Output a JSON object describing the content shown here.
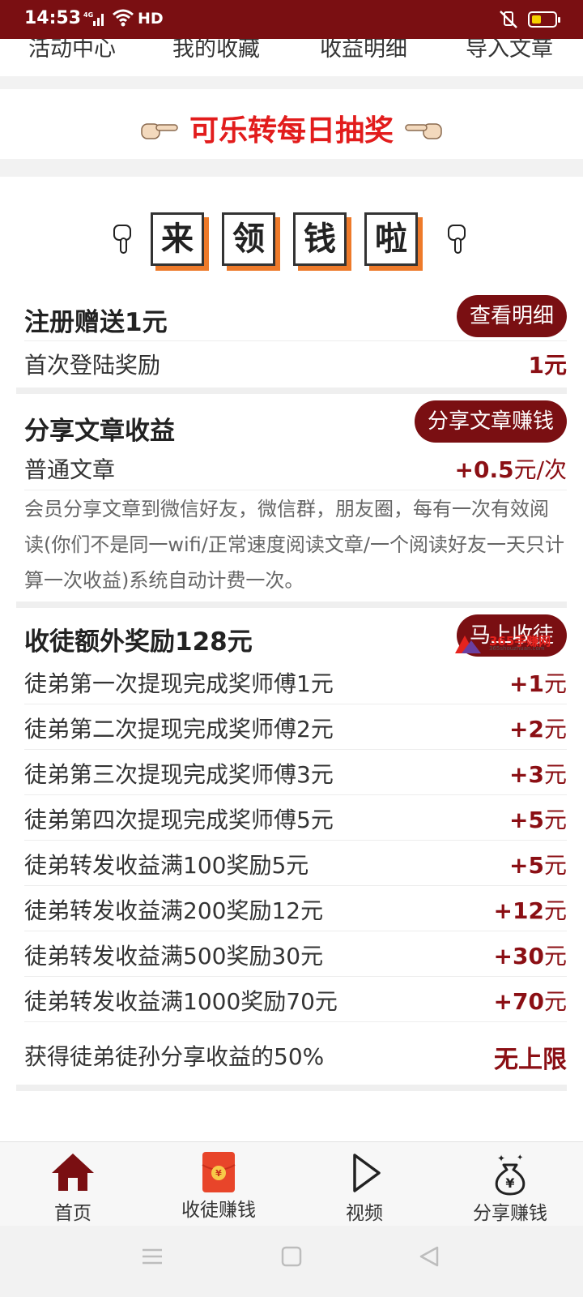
{
  "status_bar": {
    "time": "14:53",
    "network": "HD",
    "signal_icon": "signal-icon",
    "wifi_icon": "wifi-icon",
    "mute_icon": "mute-icon",
    "battery_icon": "battery-icon",
    "background_color": "#7a0f12"
  },
  "top_nav": {
    "items": [
      {
        "label": "活动中心"
      },
      {
        "label": "我的收藏"
      },
      {
        "label": "收益明细"
      },
      {
        "label": "导入文章"
      }
    ]
  },
  "lottery": {
    "text": "可乐转每日抽奖",
    "left_icon": "pointing-right-hand-icon",
    "right_icon": "pointing-left-hand-icon",
    "color": "#e21c1c"
  },
  "stamp_heading": {
    "chars": [
      "来",
      "领",
      "钱",
      "啦"
    ],
    "left_icon": "pointing-down-hand-icon",
    "right_icon": "pointing-down-hand-icon",
    "shadow_color": "#ee7a2a"
  },
  "register": {
    "title": "注册赠送1元",
    "button": "查看明细",
    "row_label": "首次登陆奖励",
    "row_value": "1元"
  },
  "share": {
    "title": "分享文章收益",
    "button": "分享文章赚钱",
    "row_label": "普通文章",
    "row_value_amount": "+0.5",
    "row_value_unit": "元/次",
    "description": "会员分享文章到微信好友，微信群，朋友圈，每有一次有效阅读(你们不是同一wifi/正常速度阅读文章/一个阅读好友一天只计算一次收益)系统自动计费一次。"
  },
  "apprentice": {
    "title": "收徒额外奖励128元",
    "button": "马上收徒",
    "rows": [
      {
        "label": "徒弟第一次提现完成奖师傅1元",
        "amount": "+1",
        "unit": "元"
      },
      {
        "label": "徒弟第二次提现完成奖师傅2元",
        "amount": "+2",
        "unit": "元"
      },
      {
        "label": "徒弟第三次提现完成奖师傅3元",
        "amount": "+3",
        "unit": "元"
      },
      {
        "label": "徒弟第四次提现完成奖师傅5元",
        "amount": "+5",
        "unit": "元"
      },
      {
        "label": "徒弟转发收益满100奖励5元",
        "amount": "+5",
        "unit": "元"
      },
      {
        "label": "徒弟转发收益满200奖励12元",
        "amount": "+12",
        "unit": "元"
      },
      {
        "label": "徒弟转发收益满500奖励30元",
        "amount": "+30",
        "unit": "元"
      },
      {
        "label": "徒弟转发收益满1000奖励70元",
        "amount": "+70",
        "unit": "元"
      }
    ],
    "final_label": "获得徒弟徒孙分享收益的50%",
    "final_value": "无上限"
  },
  "watermark": {
    "text": "365手赚网",
    "sub": "365shouzhuan.com"
  },
  "tab_bar": {
    "tabs": [
      {
        "label": "首页",
        "icon": "home-icon"
      },
      {
        "label": "收徒赚钱",
        "icon": "red-envelope-icon"
      },
      {
        "label": "视频",
        "icon": "play-icon"
      },
      {
        "label": "分享赚钱",
        "icon": "money-bag-icon"
      }
    ]
  },
  "system_nav": {
    "buttons": [
      "menu-icon",
      "home-square-icon",
      "back-triangle-icon"
    ]
  },
  "accent_color": "#7a0f12"
}
